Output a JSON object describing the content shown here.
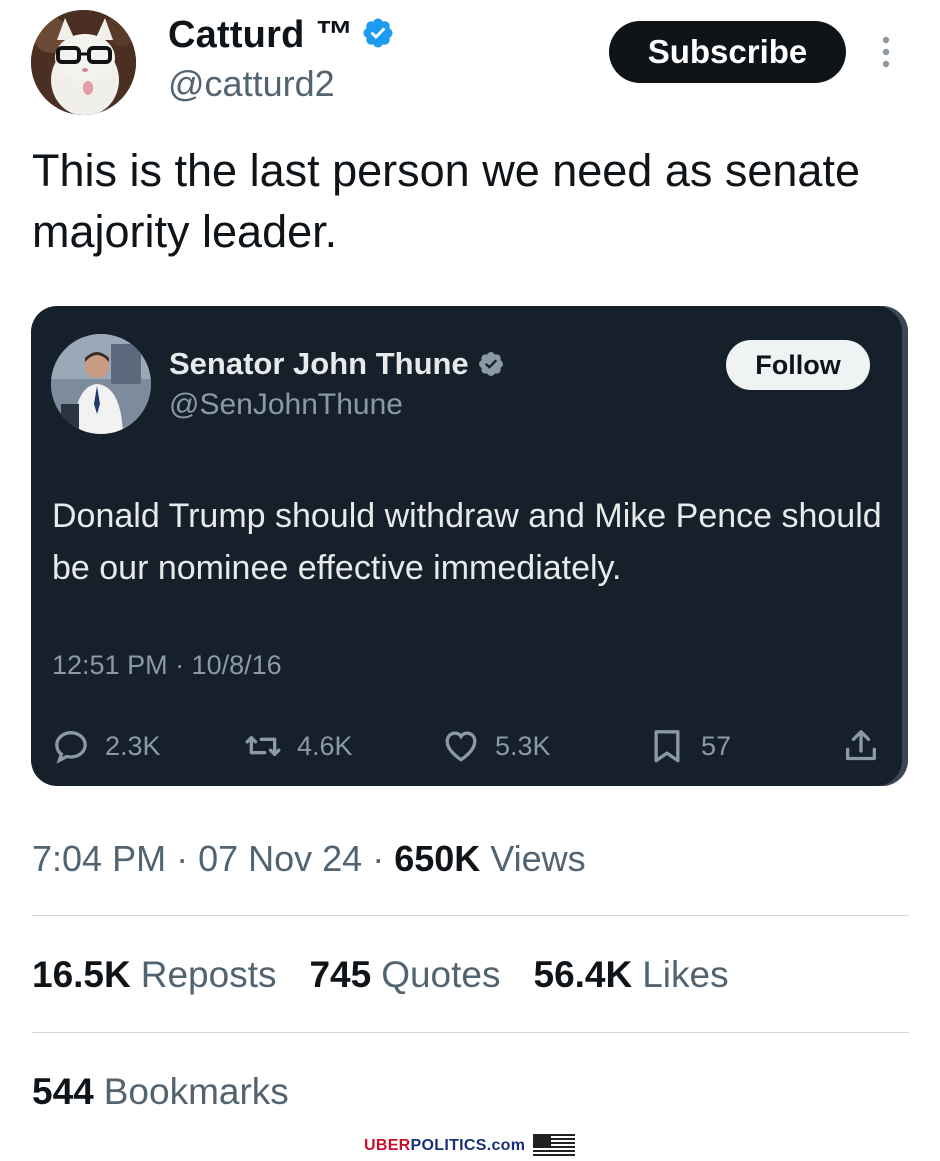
{
  "author": {
    "display_name": "Catturd ™",
    "handle": "@catturd2",
    "verified": true,
    "avatar": "cat-with-glasses-avatar"
  },
  "header": {
    "subscribe_label": "Subscribe",
    "more_icon": "more-vertical-icon"
  },
  "tweet": {
    "text": "This is the last person we need as senate majority leader."
  },
  "quoted_screenshot": {
    "display_name": "Senator John Thune",
    "handle": "@SenJohnThune",
    "verified": true,
    "follow_label": "Follow",
    "text": "Donald Trump should withdraw and Mike Pence should be our nominee effective immediately.",
    "timestamp": "12:51 PM · 10/8/16",
    "actions": {
      "replies": "2.3K",
      "reposts": "4.6K",
      "likes": "5.3K",
      "bookmarks": "57"
    }
  },
  "meta": {
    "time": "7:04 PM",
    "date": "07 Nov 24",
    "views_count": "650K",
    "views_label": "Views"
  },
  "stats": {
    "reposts_count": "16.5K",
    "reposts_label": "Reposts",
    "quotes_count": "745",
    "quotes_label": "Quotes",
    "likes_count": "56.4K",
    "likes_label": "Likes",
    "bookmarks_count": "544",
    "bookmarks_label": "Bookmarks"
  },
  "watermark": {
    "brand_part1": "UBER",
    "brand_part2": "POLITICS",
    "brand_suffix": ".com"
  },
  "colors": {
    "primary_text": "#0f1419",
    "secondary_text": "#536471",
    "verified_blue": "#1d9bf0",
    "card_background": "#15202b"
  }
}
